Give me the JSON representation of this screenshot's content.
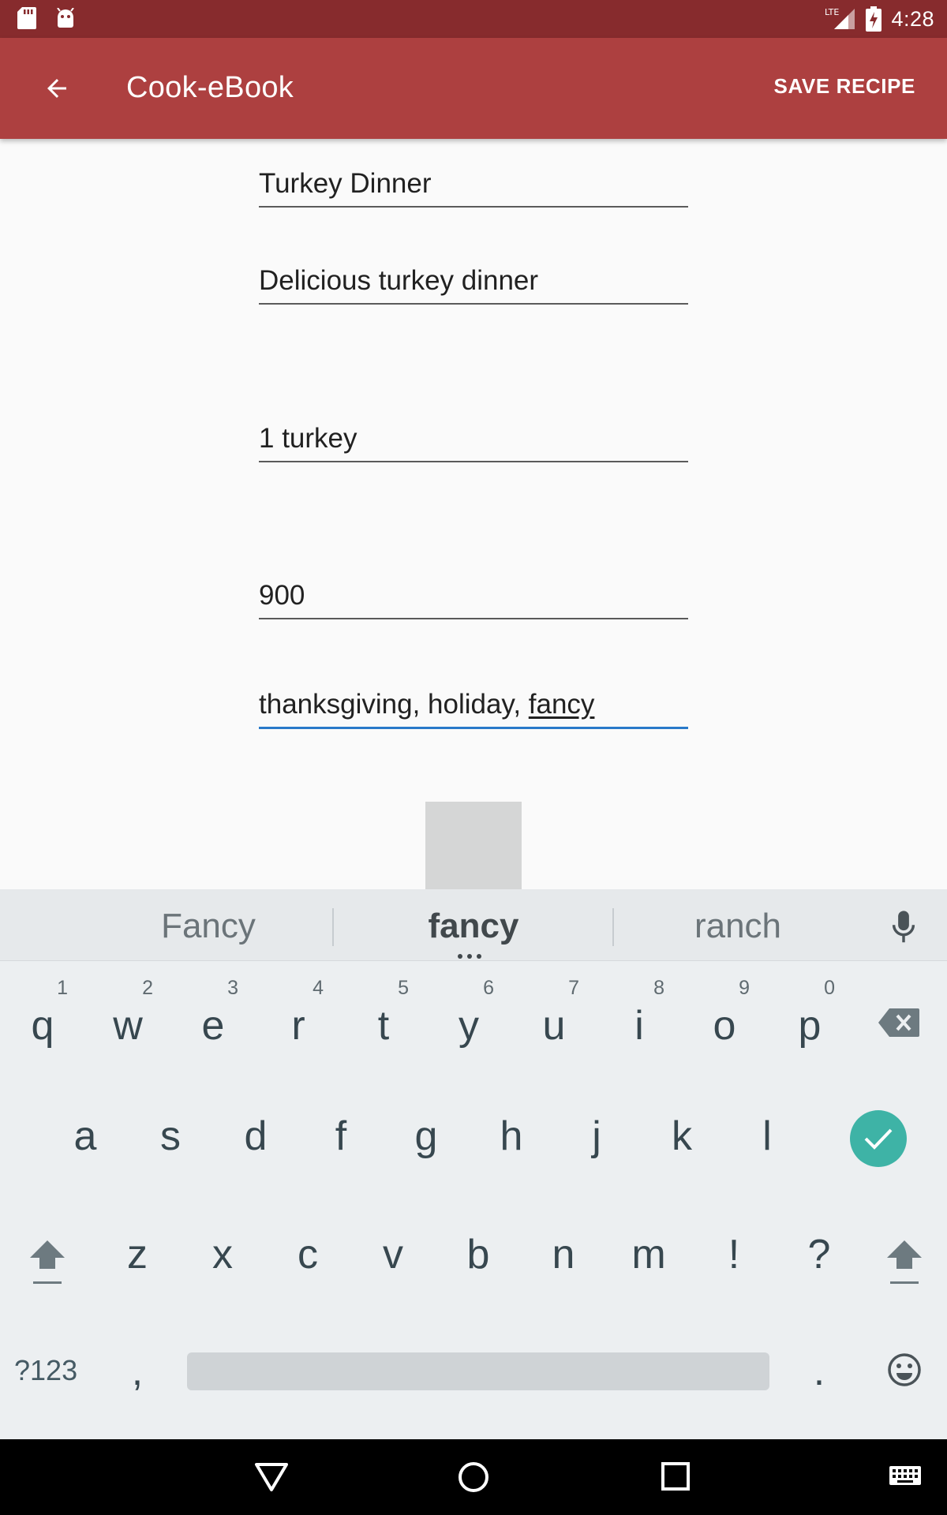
{
  "status_bar": {
    "time": "4:28",
    "network": "LTE",
    "icons": [
      "sd-card-icon",
      "android-icon",
      "signal-icon",
      "battery-charging-icon"
    ]
  },
  "app_bar": {
    "title": "Cook-eBook",
    "back_icon": "arrow-back-icon",
    "save_label": "SAVE RECIPE"
  },
  "form": {
    "recipe_name": "Turkey Dinner",
    "description": "Delicious turkey dinner",
    "ingredients": "1 turkey",
    "calories": "900",
    "tags_prefix": "thanksgiving, holiday, ",
    "tags_composing": "fancy"
  },
  "keyboard": {
    "suggestions": [
      "Fancy",
      "fancy",
      "ranch"
    ],
    "row1": [
      "q",
      "w",
      "e",
      "r",
      "t",
      "y",
      "u",
      "i",
      "o",
      "p"
    ],
    "row1_hints": [
      "1",
      "2",
      "3",
      "4",
      "5",
      "6",
      "7",
      "8",
      "9",
      "0"
    ],
    "row2": [
      "a",
      "s",
      "d",
      "f",
      "g",
      "h",
      "j",
      "k",
      "l"
    ],
    "row3": [
      "z",
      "x",
      "c",
      "v",
      "b",
      "n",
      "m",
      "!",
      "?"
    ],
    "symbols_label": "?123",
    "comma": ",",
    "period": "."
  },
  "colors": {
    "status_bar": "#872b2d",
    "app_bar": "#ad4040",
    "focus_underline": "#2979c9",
    "enter_key": "#3eb3a6"
  }
}
